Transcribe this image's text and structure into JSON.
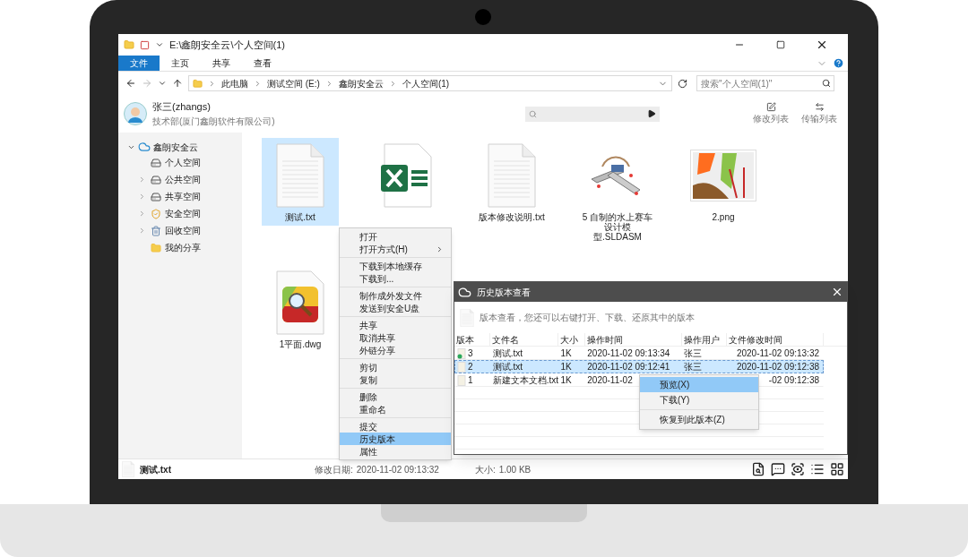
{
  "window": {
    "title": "E:\\鑫朗安全云\\个人空间(1)"
  },
  "ribbon": {
    "tabs": [
      {
        "label": "文件",
        "selected": true
      },
      {
        "label": "主页",
        "selected": false
      },
      {
        "label": "共享",
        "selected": false
      },
      {
        "label": "查看",
        "selected": false
      }
    ]
  },
  "address": {
    "path": [
      "此电脑",
      "测试空间 (E:)",
      "鑫朗安全云",
      "个人空间(1)"
    ],
    "search_placeholder": "搜索\"个人空间(1)\""
  },
  "user": {
    "name": "张三(zhangs)",
    "department": "技术部(厦门鑫朗软件有限公司)",
    "actions": [
      {
        "label": "修改列表",
        "kind": "edit"
      },
      {
        "label": "传输列表",
        "kind": "transfer"
      }
    ]
  },
  "sidebar": {
    "root": {
      "label": "鑫朗安全云",
      "expanded": true,
      "children": [
        {
          "label": "个人空间",
          "kind": "drive",
          "expandable": false
        },
        {
          "label": "公共空间",
          "kind": "drive",
          "expandable": true
        },
        {
          "label": "共享空间",
          "kind": "drive",
          "expandable": true
        },
        {
          "label": "安全空间",
          "kind": "secure",
          "expandable": true
        },
        {
          "label": "回收空间",
          "kind": "recycle",
          "expandable": true
        },
        {
          "label": "我的分享",
          "kind": "folder",
          "expandable": false
        }
      ]
    }
  },
  "files": [
    {
      "name": "测试.txt",
      "kind": "text",
      "selected": true
    },
    {
      "kind": "spreadsheet",
      "selected": false
    },
    {
      "name": "版本修改说明.txt",
      "kind": "text",
      "selected": false
    },
    {
      "name": "5 自制的水上赛车设计模型.SLDASM",
      "kind": "model",
      "selected": false
    },
    {
      "name": "2.png",
      "kind": "image",
      "selected": false
    },
    {
      "name": "1平面.dwg",
      "kind": "cad",
      "selected": false
    }
  ],
  "context_menu": {
    "groups": [
      {
        "items": [
          {
            "label": "打开",
            "selected": false,
            "submenu": false
          },
          {
            "label": "打开方式(H)",
            "selected": false,
            "submenu": true
          }
        ]
      },
      {
        "items": [
          {
            "label": "下载到本地缓存",
            "selected": false,
            "submenu": false
          },
          {
            "label": "下载到...",
            "selected": false,
            "submenu": false
          }
        ]
      },
      {
        "items": [
          {
            "label": "制作成外发文件",
            "selected": false,
            "submenu": false
          },
          {
            "label": "发送到安全U盘",
            "selected": false,
            "submenu": false
          }
        ]
      },
      {
        "items": [
          {
            "label": "共享",
            "selected": false,
            "submenu": false
          },
          {
            "label": "取消共享",
            "selected": false,
            "submenu": false
          },
          {
            "label": "外链分享",
            "selected": false,
            "submenu": false
          }
        ]
      },
      {
        "items": [
          {
            "label": "剪切",
            "selected": false,
            "submenu": false
          },
          {
            "label": "复制",
            "selected": false,
            "submenu": false
          }
        ]
      },
      {
        "items": [
          {
            "label": "删除",
            "selected": false,
            "submenu": false
          },
          {
            "label": "重命名",
            "selected": false,
            "submenu": false
          }
        ]
      },
      {
        "items": [
          {
            "label": "提交",
            "selected": false,
            "submenu": false
          },
          {
            "label": "历史版本",
            "selected": true,
            "submenu": false
          },
          {
            "label": "属性",
            "selected": false,
            "submenu": false
          }
        ]
      }
    ]
  },
  "history_dialog": {
    "title": "历史版本查看",
    "hint": "版本查看，您还可以右键打开、下载、还原其中的版本",
    "columns": [
      "版本",
      "文件名",
      "大小",
      "操作时间",
      "操作用户",
      "文件修改时间"
    ],
    "rows": [
      {
        "version": "3",
        "file": "测试.txt",
        "size": "1K",
        "op_time": "2020-11-02 09:13:34",
        "user": "张三",
        "modified": "2020-11-02 09:13:32",
        "selected": false,
        "current": true
      },
      {
        "version": "2",
        "file": "测试.txt",
        "size": "1K",
        "op_time": "2020-11-02 09:12:41",
        "user": "张三",
        "modified": "2020-11-02 09:12:38",
        "selected": true,
        "current": false
      },
      {
        "version": "1",
        "file": "新建文本文档.txt",
        "size": "1K",
        "op_time": "2020-11-02",
        "modified": "-02 09:12:38",
        "selected": false,
        "current": false
      }
    ],
    "row_menu": {
      "groups": [
        {
          "items": [
            {
              "label": "预览(X)",
              "selected": true
            },
            {
              "label": "下载(Y)",
              "selected": false
            }
          ]
        },
        {
          "items": [
            {
              "label": "恢复到此版本(Z)",
              "selected": false
            }
          ]
        }
      ]
    }
  },
  "status_bar": {
    "file": "测试.txt",
    "modified_label": "修改日期:",
    "modified": "2020-11-02 09:13:32",
    "size_label": "大小:",
    "size": "1.00 KB"
  }
}
